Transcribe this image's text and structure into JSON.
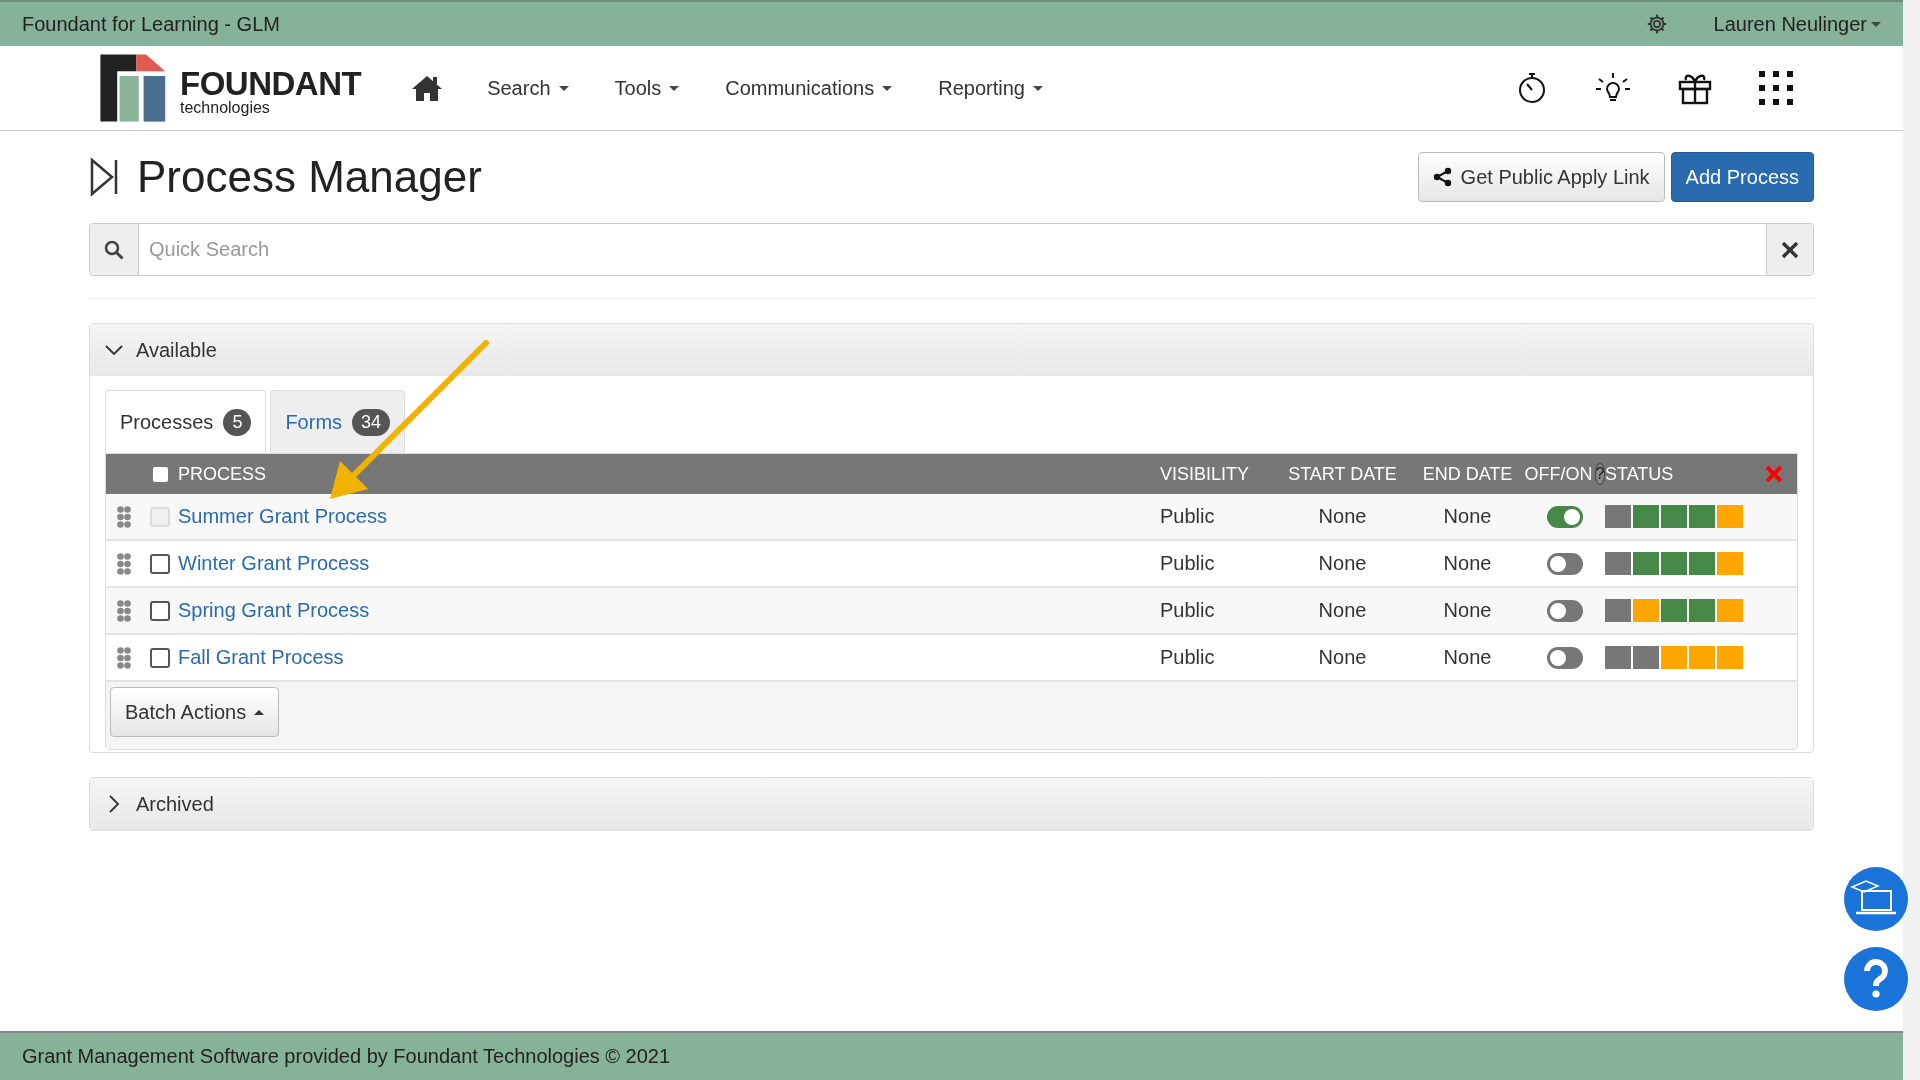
{
  "top_bar": {
    "title": "Foundant for Learning - GLM",
    "user": "Lauren Neulinger"
  },
  "logo": {
    "name": "FOUNDANT",
    "tagline": "technologies"
  },
  "nav": [
    {
      "label": "Search"
    },
    {
      "label": "Tools"
    },
    {
      "label": "Communications"
    },
    {
      "label": "Reporting"
    }
  ],
  "page": {
    "title": "Process Manager",
    "buttons": [
      {
        "label": "Get Public Apply Link",
        "kind": "share"
      },
      {
        "label": "Add Process",
        "kind": "primary"
      }
    ]
  },
  "search": {
    "placeholder": "Quick Search"
  },
  "sections": [
    {
      "title": "Available",
      "expanded": true,
      "tabs": [
        {
          "label": "Processes",
          "count": "5",
          "selected": true
        },
        {
          "label": "Forms",
          "count": "34",
          "selected": false
        }
      ],
      "table": {
        "select_all_checked": false,
        "help_symbol": "?",
        "columns": [
          "PROCESS",
          "VISIBILITY",
          "START DATE",
          "END DATE",
          "OFF/ON",
          "STATUS"
        ],
        "rows": [
          {
            "name": "Summer Grant Process",
            "visibility": "Public",
            "start_date": "None",
            "end_date": "None",
            "disabled": true,
            "on": true,
            "status": [
              {
                "color": "#777777"
              },
              {
                "color": "#468847"
              },
              {
                "color": "#468847"
              },
              {
                "color": "#468847"
              },
              {
                "color": "#ffa500"
              }
            ]
          },
          {
            "name": "Winter Grant Process",
            "visibility": "Public",
            "start_date": "None",
            "end_date": "None",
            "disabled": false,
            "on": false,
            "status": [
              {
                "color": "#777777"
              },
              {
                "color": "#468847"
              },
              {
                "color": "#468847"
              },
              {
                "color": "#468847"
              },
              {
                "color": "#ffa500"
              }
            ]
          },
          {
            "name": "Spring Grant Process",
            "visibility": "Public",
            "start_date": "None",
            "end_date": "None",
            "disabled": false,
            "on": false,
            "status": [
              {
                "color": "#777777"
              },
              {
                "color": "#ffa500"
              },
              {
                "color": "#468847"
              },
              {
                "color": "#468847"
              },
              {
                "color": "#ffa500"
              }
            ]
          },
          {
            "name": "Fall Grant Process",
            "visibility": "Public",
            "start_date": "None",
            "end_date": "None",
            "disabled": false,
            "on": false,
            "status": [
              {
                "color": "#777777"
              },
              {
                "color": "#777777"
              },
              {
                "color": "#ffa500"
              },
              {
                "color": "#ffa500"
              },
              {
                "color": "#ffa500"
              }
            ]
          }
        ]
      },
      "batch_button": "Batch Actions"
    },
    {
      "title": "Archived",
      "expanded": false
    }
  ],
  "footer": "Grant Management Software provided by Foundant Technologies © 2021"
}
